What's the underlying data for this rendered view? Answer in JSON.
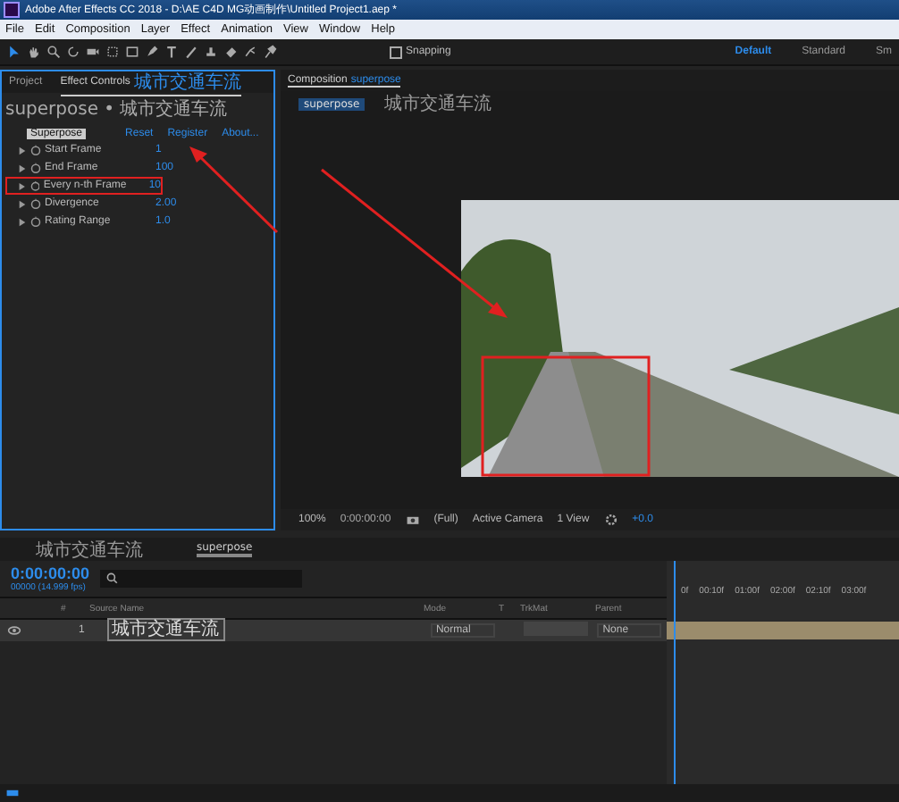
{
  "window": {
    "title": "Adobe After Effects CC 2018 - D:\\AE C4D MG动画制作\\Untitled Project1.aep *"
  },
  "menu": [
    "File",
    "Edit",
    "Composition",
    "Layer",
    "Effect",
    "Animation",
    "View",
    "Window",
    "Help"
  ],
  "toolbar": {
    "snapping": {
      "label": "Snapping",
      "checked": false
    },
    "workspaces": [
      {
        "label": "Default",
        "selected": true
      },
      {
        "label": "Standard",
        "selected": false
      },
      {
        "label": "Sm",
        "selected": false
      }
    ]
  },
  "left_panel": {
    "tabs": [
      {
        "label": "Project",
        "selected": false
      },
      {
        "label": "Effect Controls",
        "layer": "城市交通车流",
        "selected": true
      }
    ],
    "breadcrumb": "superpose • 城市交通车流",
    "effect": {
      "name": "Superpose",
      "actions": [
        "Reset",
        "Register",
        "About..."
      ],
      "params": [
        {
          "name": "Start Frame",
          "value": "1",
          "highlighted": false
        },
        {
          "name": "End Frame",
          "value": "100",
          "highlighted": false
        },
        {
          "name": "Every n-th Frame",
          "value": "10",
          "highlighted": true
        },
        {
          "name": "Divergence",
          "value": "2.00",
          "highlighted": false
        },
        {
          "name": "Rating Range",
          "value": "1.0",
          "highlighted": false
        }
      ]
    }
  },
  "composition": {
    "tab_label": "Composition",
    "tab_name": "superpose",
    "subtabs": [
      {
        "label": "superpose",
        "selected": true
      },
      {
        "label": "城市交通车流",
        "selected": false
      }
    ],
    "controls": {
      "zoom": "100%",
      "time": "0:00:00:00",
      "resolution": "(Full)",
      "camera": "Active Camera",
      "views": "1 View",
      "exposure": "+0.0"
    }
  },
  "timeline": {
    "tabs": [
      {
        "label": "城市交通车流",
        "selected": false
      },
      {
        "label": "superpose",
        "selected": true
      }
    ],
    "time": "0:00:00:00",
    "frames": "00000 (14.999 fps)",
    "columns": {
      "number": "#",
      "source": "Source Name",
      "mode": "Mode",
      "t": "T",
      "trkmat": "TrkMat",
      "parent": "Parent"
    },
    "layers": [
      {
        "number": "1",
        "name": "城市交通车流",
        "mode": "Normal",
        "parent": "None"
      }
    ],
    "ruler": [
      "0f",
      "00:10f",
      "01:00f",
      "02:00f",
      "02:10f",
      "03:00f"
    ]
  }
}
